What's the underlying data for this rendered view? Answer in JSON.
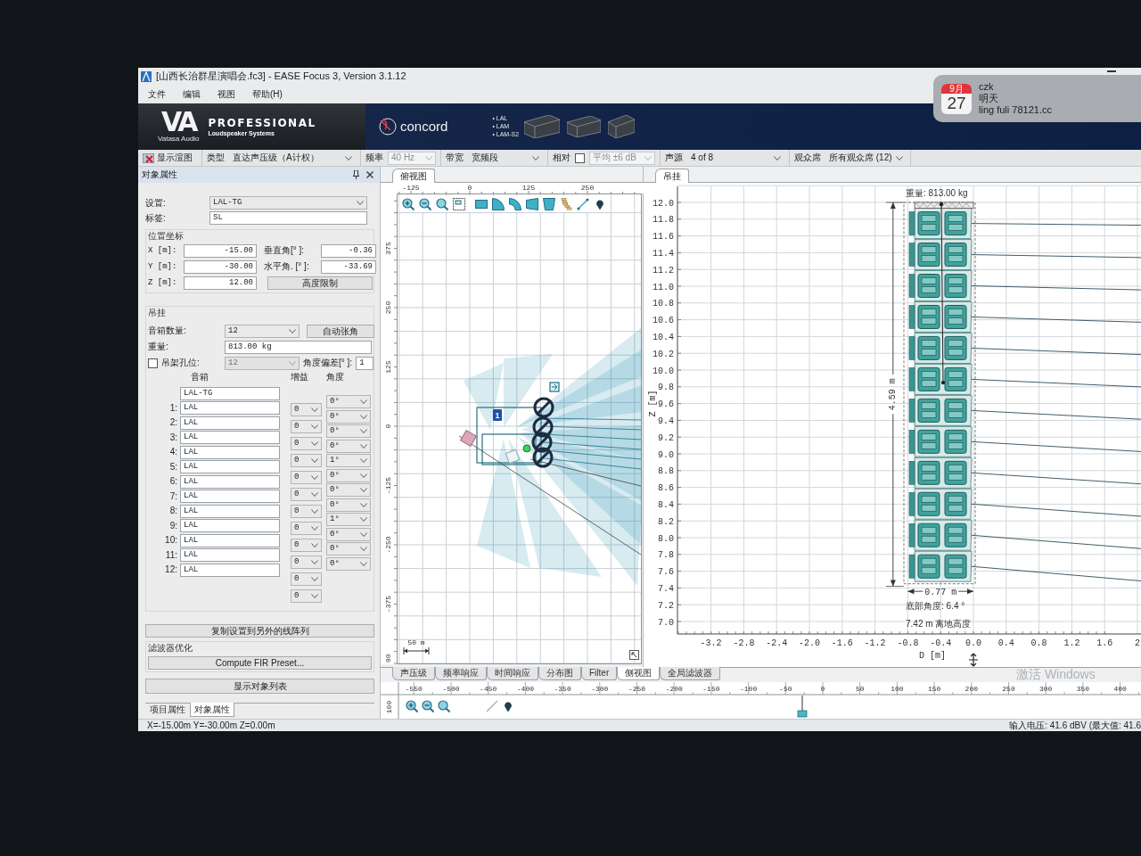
{
  "window": {
    "title": "[山西长治群星演唱会.fc3] - EASE Focus 3, Version 3.1.12"
  },
  "notification": {
    "month": "9月",
    "day": "27",
    "sender": "czk",
    "title": "明天",
    "body": "ling fuli 78121.cc"
  },
  "menu": [
    "文件",
    "编辑",
    "视图",
    "帮助(H)"
  ],
  "banner": {
    "logo": "VA",
    "maker": "Vatasa Audio",
    "headline": "PROFESSIONAL",
    "subline": "Loudspeaker Systems",
    "series": "concord",
    "models": [
      "• LAL",
      "• LAM",
      "• LAM-S2"
    ]
  },
  "toolbar": [
    {
      "kind": "toggle",
      "label": "显示渲图"
    },
    {
      "kind": "combo",
      "label": "类型",
      "value": "直达声压级（A计权）",
      "disabled": false
    },
    {
      "kind": "combo",
      "label": "频率",
      "value": "40 Hz",
      "disabled": true
    },
    {
      "kind": "combo",
      "label": "带宽",
      "value": "宽频段",
      "disabled": false
    },
    {
      "kind": "check-combo",
      "label": "相对",
      "checked": false,
      "value": "平均 ±6 dB",
      "disabled": true
    },
    {
      "kind": "combo",
      "label": "声源",
      "value": "4 of 8",
      "disabled": false
    },
    {
      "kind": "combo",
      "label": "观众席",
      "value": "所有观众席 (12)",
      "disabled": false
    }
  ],
  "object_panel": {
    "title": "对象属性",
    "setup_label": "设置:",
    "setup_value": "LAL-TG",
    "tag_label": "标签:",
    "tag_value": "SL",
    "position_title": "位置坐标",
    "coords": [
      {
        "label": "X [m]:",
        "value": "-15.00"
      },
      {
        "label": "Y [m]:",
        "value": "-30.00"
      },
      {
        "label": "Z [m]:",
        "value": "12.00"
      }
    ],
    "aim": [
      {
        "label": "垂直角[° ]:",
        "value": "-0.36"
      },
      {
        "label": "水平角. [° ]:",
        "value": "-33.69"
      }
    ],
    "height_button": "高度限制",
    "rigging_title": "吊挂",
    "count_label": "音箱数量:",
    "count_value": "12",
    "auto_button": "自动张角",
    "weight_label": "重量:",
    "weight_value": "813.00 kg",
    "pickpoint_label": "吊架孔位:",
    "pickpoint_checked": false,
    "pickpoint_value": "12",
    "offset_label": "角度偏差[° ]:",
    "offset_value": "1",
    "columns": [
      "音箱",
      "增益",
      "角度"
    ],
    "frame": "LAL-TG",
    "cabinets": [
      {
        "index": "1:",
        "model": "LAL"
      },
      {
        "index": "2:",
        "model": "LAL"
      },
      {
        "index": "3:",
        "model": "LAL"
      },
      {
        "index": "4:",
        "model": "LAL"
      },
      {
        "index": "5:",
        "model": "LAL"
      },
      {
        "index": "6:",
        "model": "LAL"
      },
      {
        "index": "7:",
        "model": "LAL"
      },
      {
        "index": "8:",
        "model": "LAL"
      },
      {
        "index": "9:",
        "model": "LAL"
      },
      {
        "index": "10:",
        "model": "LAL"
      },
      {
        "index": "11:",
        "model": "LAL"
      },
      {
        "index": "12:",
        "model": "LAL"
      }
    ],
    "gains": [
      "0",
      "0",
      "0",
      "0",
      "0",
      "0",
      "0",
      "0",
      "0",
      "0",
      "0",
      "0"
    ],
    "splay": [
      "0°",
      "0°",
      "0°",
      "0°",
      "1°",
      "0°",
      "0°",
      "0°",
      "1°",
      "0°",
      "0°",
      "0°"
    ],
    "copy_button": "复制设置到另外的线阵列",
    "filter_title": "滤波器优化",
    "fir_button": "Compute FIR Preset...",
    "list_button": "显示对象列表",
    "tabs": [
      {
        "label": "项目属性",
        "selected": false
      },
      {
        "label": "对象属性",
        "selected": true
      }
    ]
  },
  "top_view": {
    "tab": "俯视图",
    "x_ruler": [
      "-125",
      "0",
      "125",
      "250"
    ],
    "y_ruler": [
      "375",
      "250",
      "125",
      "0",
      "-125",
      "-250",
      "-375",
      "00"
    ],
    "scale": "50 m",
    "source_number": "1"
  },
  "side_view": {
    "tab": "吊挂",
    "y_ticks": [
      "12.0",
      "11.8",
      "11.6",
      "11.4",
      "11.2",
      "11.0",
      "10.8",
      "10.6",
      "10.4",
      "10.2",
      "10.0",
      "9.8",
      "9.6",
      "9.4",
      "9.2",
      "9.0",
      "8.8",
      "8.6",
      "8.4",
      "8.2",
      "8.0",
      "7.8",
      "7.6",
      "7.4",
      "7.2",
      "7.0"
    ],
    "x_ticks": [
      "-3.2",
      "-2.8",
      "-2.4",
      "-2.0",
      "-1.6",
      "-1.2",
      "-0.8",
      "-0.4",
      "0.0",
      "0.4",
      "0.8",
      "1.2",
      "1.6",
      "2"
    ],
    "y_label": "Z [m]",
    "x_label": "D [m]",
    "weight": "重量: 813.00 kg",
    "array_height": "4.59 m",
    "array_depth": "0.77 m",
    "bottom_angle": "底部角度: 6.4 °",
    "trim_height": "7.42 m 离地高度"
  },
  "view_tabs": [
    {
      "label": "声压级",
      "selected": false
    },
    {
      "label": "频率响应",
      "selected": false
    },
    {
      "label": "时间响应",
      "selected": false
    },
    {
      "label": "分布图",
      "selected": false
    },
    {
      "label": "Filter",
      "selected": false
    },
    {
      "label": "侧视图",
      "selected": true
    },
    {
      "label": "全局滤波器",
      "selected": false
    }
  ],
  "timeline": {
    "side_label": "100",
    "ruler": [
      "-550",
      "-500",
      "-450",
      "-400",
      "-350",
      "-300",
      "-250",
      "-200",
      "-150",
      "-100",
      "-50",
      "0",
      "50",
      "100",
      "150",
      "200",
      "250",
      "300",
      "350",
      "400"
    ]
  },
  "status_bar": {
    "position": "X=-15.00m Y=-30.00m Z=0.00m",
    "voltage": "输入电压: 41.6 dBV (最大值: 41.6"
  },
  "os_notice": "激活 Windows"
}
